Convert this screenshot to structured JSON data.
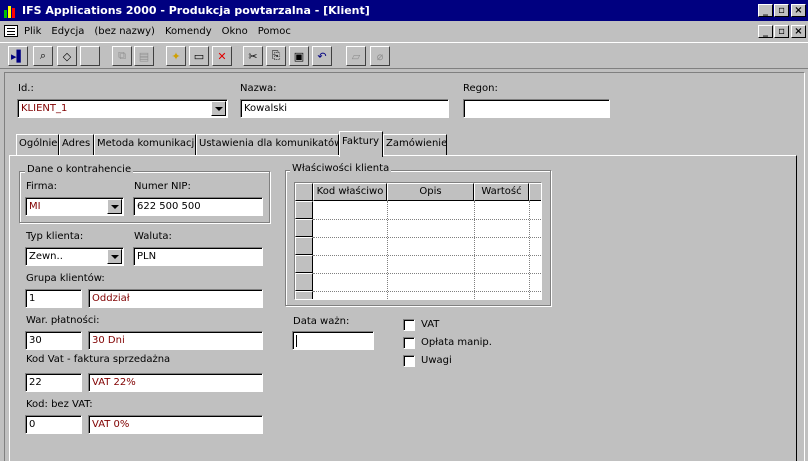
{
  "window": {
    "title": "IFS Applications 2000 - Produkcja powtarzalna - [Klient]"
  },
  "menu": [
    "Plik",
    "Edycja",
    "(bez nazwy)",
    "Komendy",
    "Okno",
    "Pomoc"
  ],
  "header": {
    "id_label": "Id.:",
    "id_value": "KLIENT_1",
    "name_label": "Nazwa:",
    "name_value": "Kowalski",
    "regon_label": "Regon:",
    "regon_value": ""
  },
  "tabs": [
    {
      "label": "Ogólnie",
      "active": false
    },
    {
      "label": "Adres",
      "active": false
    },
    {
      "label": "Metoda komunikacji",
      "active": false
    },
    {
      "label": "Ustawienia dla komunikatów",
      "active": false
    },
    {
      "label": "Faktury",
      "active": true
    },
    {
      "label": "Zamówienie",
      "active": false
    }
  ],
  "contractor": {
    "group_title": "Dane o kontrahencie",
    "company_label": "Firma:",
    "company_value": "MI",
    "nip_label": "Numer NIP:",
    "nip_value": "622 500 500"
  },
  "client_type": {
    "label": "Typ klienta:",
    "value": "Zewn.."
  },
  "currency": {
    "label": "Waluta:",
    "value": "PLN"
  },
  "client_group": {
    "label": "Grupa klientów:",
    "code": "1",
    "desc": "Oddział"
  },
  "payment_terms": {
    "label": "War. płatności:",
    "code": "30",
    "desc": "30 Dni"
  },
  "vat_code": {
    "label": "Kod Vat - faktura sprzedażna",
    "code": "22",
    "desc": "VAT 22%"
  },
  "no_vat_code": {
    "label": "Kod: bez VAT:",
    "code": "0",
    "desc": "VAT 0%"
  },
  "properties": {
    "group_title": "Właściwości klienta",
    "columns": [
      "Kod właściwo",
      "Opis",
      "Wartość"
    ]
  },
  "valid_date": {
    "label": "Data ważn:",
    "value": ""
  },
  "checkboxes": [
    {
      "label": "VAT",
      "checked": false
    },
    {
      "label": "Opłata manip.",
      "checked": false
    },
    {
      "label": "Uwagi",
      "checked": false
    }
  ],
  "colors": {
    "title_bg": "#000080",
    "face": "#c0c0c0",
    "red_text": "#800000"
  }
}
